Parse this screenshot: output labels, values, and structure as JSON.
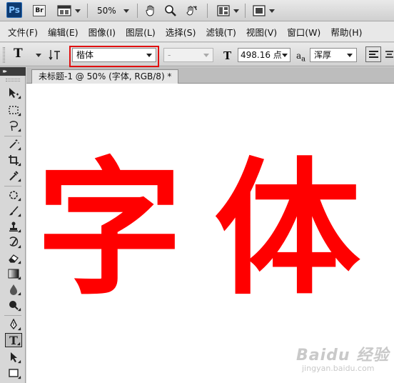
{
  "appbar": {
    "logo": "Ps",
    "bridge": "Br",
    "zoom": "50%",
    "icons": [
      "photoshop-logo",
      "bridge-icon",
      "film-strip-icon",
      "hand-icon",
      "zoom-icon",
      "rotate-icon",
      "arrange-icon",
      "screen-mode-icon"
    ]
  },
  "menu": [
    "文件(F)",
    "编辑(E)",
    "图像(I)",
    "图层(L)",
    "选择(S)",
    "滤镜(T)",
    "视图(V)",
    "窗口(W)",
    "帮助(H)"
  ],
  "options": {
    "tool_glyph": "T",
    "font_family": "楷体",
    "font_style": "-",
    "font_size": "498.16 点",
    "anti_alias": "浑厚",
    "highlight_color": "#e01010"
  },
  "document": {
    "tab_title": "未标题-1 @ 50% (字体, RGB/8) *",
    "text_left": "字",
    "text_right": "体",
    "text_color": "#ff0000",
    "watermark": "Baidu 经验",
    "watermark_sub": "jingyan.baidu.com"
  },
  "toolbox": {
    "tools": [
      "move-tool",
      "marquee-tool",
      "lasso-tool",
      "magic-wand-tool",
      "crop-tool",
      "eyedropper-tool",
      "healing-brush-tool",
      "brush-tool",
      "clone-stamp-tool",
      "history-brush-tool",
      "eraser-tool",
      "gradient-tool",
      "blur-tool",
      "dodge-tool",
      "pen-tool",
      "type-tool",
      "path-selection-tool",
      "rectangle-tool"
    ]
  }
}
